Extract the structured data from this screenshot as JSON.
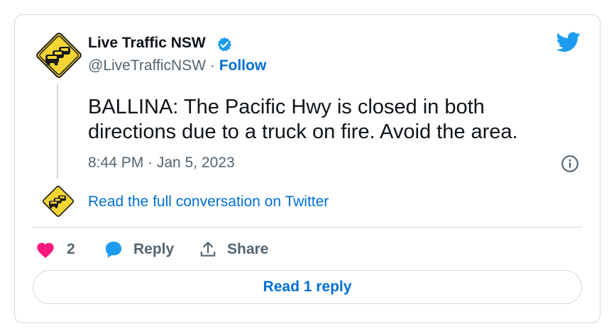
{
  "author": {
    "name": "Live Traffic NSW",
    "handle": "@LiveTrafficNSW",
    "separator": " · ",
    "follow_label": "Follow",
    "verified": true
  },
  "tweet": {
    "text": "BALLINA: The Pacific Hwy is closed in both directions due to a truck on fire. Avoid the area.",
    "timestamp": "8:44 PM · Jan 5, 2023"
  },
  "thread": {
    "read_conversation_label": "Read the full conversation on Twitter"
  },
  "actions": {
    "like_count": "2",
    "reply_label": "Reply",
    "share_label": "Share"
  },
  "footer": {
    "read_replies_label": "Read 1 reply"
  },
  "icons": {
    "logo": "twitter-bird-icon",
    "verified": "verified-badge-icon",
    "info": "info-icon",
    "like": "heart-icon",
    "reply": "speech-bubble-icon",
    "share": "share-upload-icon",
    "avatar": "traffic-warning-sign"
  },
  "colors": {
    "brand_blue": "#1d9bf0",
    "link_blue": "#006fd6",
    "like_pink": "#f91880",
    "text_primary": "#0f1419",
    "text_secondary": "#536471",
    "border": "#cfd9de",
    "sign_yellow": "#f5d533"
  }
}
